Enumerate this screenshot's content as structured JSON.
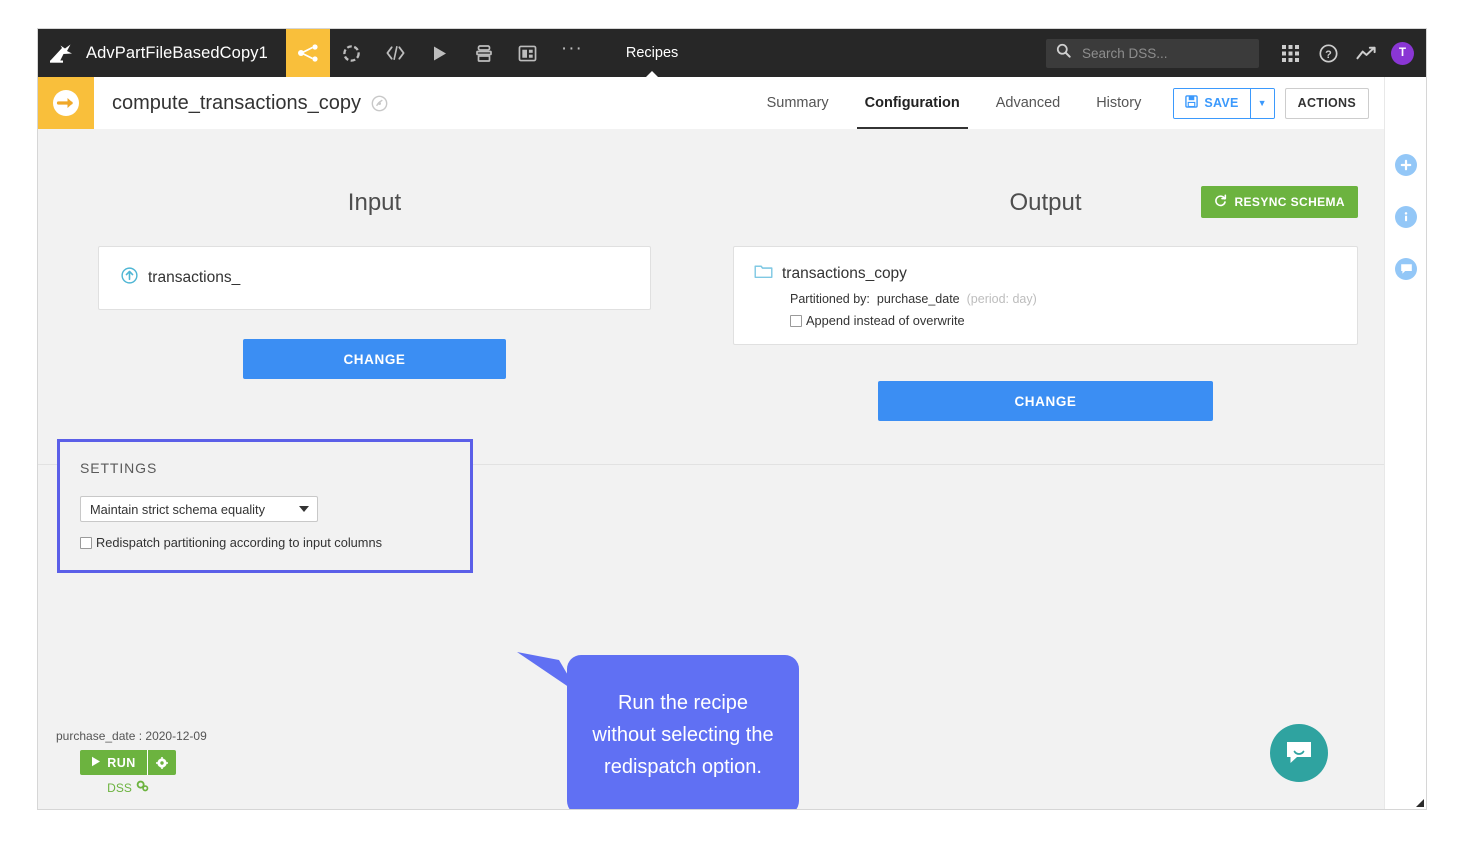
{
  "navbar": {
    "logo_icon": "dataiku-bird-logo",
    "project_name": "AdvPartFileBasedCopy1",
    "icons": [
      {
        "name": "flow-icon",
        "active": true
      },
      {
        "name": "lab-icon",
        "active": false
      },
      {
        "name": "code-icon",
        "active": false
      },
      {
        "name": "jobs-play-icon",
        "active": false
      },
      {
        "name": "notebooks-icon",
        "active": false
      },
      {
        "name": "dashboards-icon",
        "active": false
      },
      {
        "name": "more-ellipsis-icon",
        "active": false
      }
    ],
    "section_label": "Recipes",
    "search": {
      "icon": "search-icon",
      "placeholder": "Search DSS...",
      "value": ""
    },
    "apps_icon": "apps-grid-icon",
    "help_icon": "help-question-icon",
    "activity_icon": "trend-line-icon",
    "avatar_initial": "T",
    "avatar_color": "#8a36d4"
  },
  "subheader": {
    "recipe_icon": "sync-recipe-arrow-icon",
    "recipe_icon_bg": "#f9bf3b",
    "title": "compute_transactions_copy",
    "status_icon": "recipe-status-icon",
    "tabs": [
      {
        "label": "Summary",
        "selected": false
      },
      {
        "label": "Configuration",
        "selected": true
      },
      {
        "label": "Advanced",
        "selected": false
      },
      {
        "label": "History",
        "selected": false
      }
    ],
    "save_label": "SAVE",
    "save_icon": "floppy-save-icon",
    "save_caret_icon": "chevron-down-icon",
    "actions_label": "ACTIONS",
    "collapse_icon": "arrow-left-icon",
    "accent_color": "#3b99fc"
  },
  "main": {
    "input": {
      "heading": "Input",
      "dataset_icon": "input-dataset-upload-icon",
      "dataset_name": "transactions_",
      "change_label": "CHANGE"
    },
    "output": {
      "heading": "Output",
      "resync_label": "RESYNC SCHEMA",
      "resync_icon": "refresh-icon",
      "resync_color": "#6cb33f",
      "dataset_icon": "folder-dataset-icon",
      "dataset_name": "transactions_copy",
      "partition_label": "Partitioned by:",
      "partition_value": "purchase_date",
      "partition_period": "(period: day)",
      "append_checkbox_label": "Append instead of overwrite",
      "append_checked": false,
      "change_label": "CHANGE"
    },
    "settings": {
      "title": "SETTINGS",
      "highlight_color": "#5b5fe8",
      "schema_mode": "Maintain strict schema equality",
      "schema_options": [
        "Maintain strict schema equality"
      ],
      "redispatch_label": "Redispatch partitioning according to input columns",
      "redispatch_checked": false
    },
    "callout": {
      "text": "Run the recipe without selecting the redispatch option.",
      "color": "#6070f3"
    },
    "run": {
      "partition_text": "purchase_date : 2020-12-09",
      "run_label": "RUN",
      "run_play_icon": "play-icon",
      "run_gear_icon": "gear-icon",
      "run_color": "#6cb33f",
      "engine_label": "DSS",
      "engine_icon": "engine-gears-icon"
    }
  },
  "right_rail": {
    "items": [
      {
        "name": "add-plus-icon",
        "glyph": "+"
      },
      {
        "name": "info-icon",
        "glyph": "i"
      },
      {
        "name": "discussions-chat-icon",
        "glyph": "chat"
      }
    ],
    "color": "#93c7f7"
  },
  "intercom": {
    "icon": "intercom-chat-icon",
    "color": "#2fa3a0"
  }
}
